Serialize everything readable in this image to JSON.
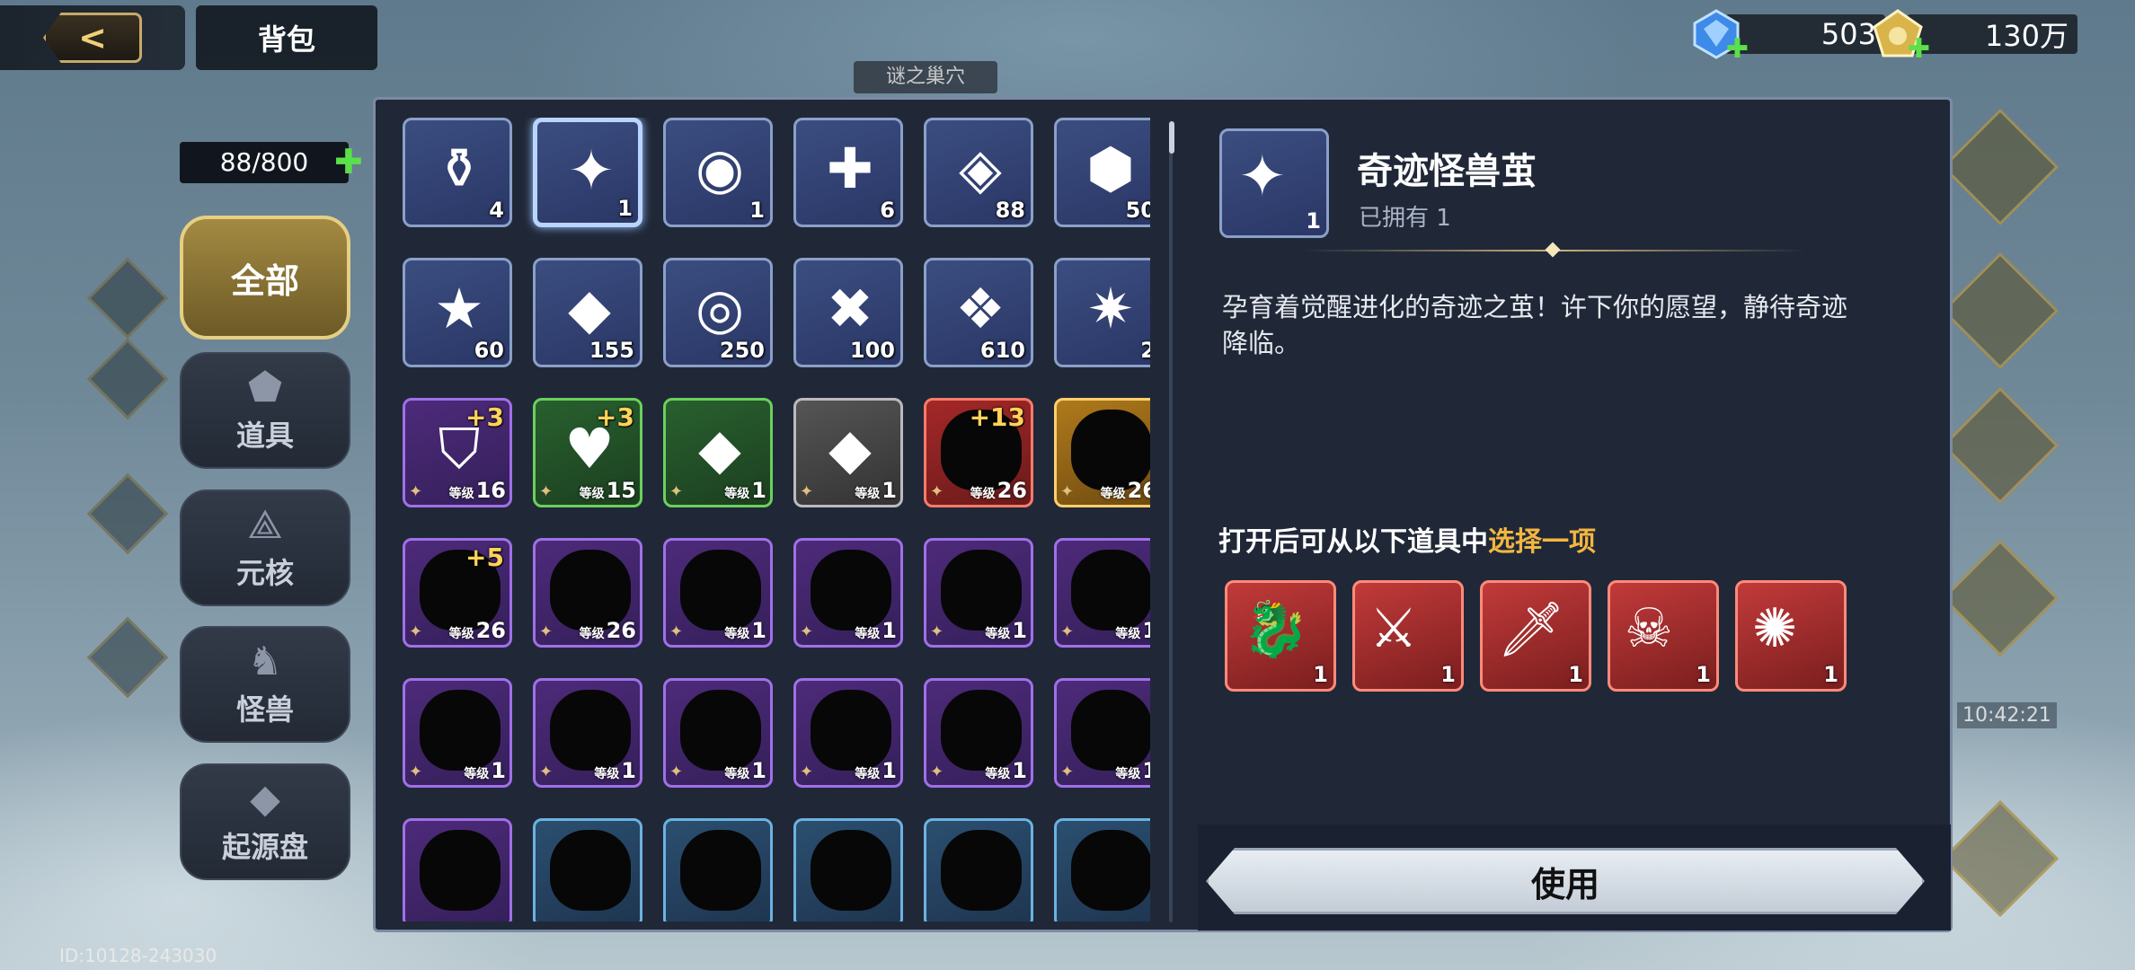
{
  "header": {
    "back_icon": "back-arrow-icon",
    "title": "背包",
    "sub_title": "谜之巢穴"
  },
  "currencies": [
    {
      "name": "blue-gem",
      "icon": "blue-crystal-icon",
      "value": "503",
      "color": "#4aa8ff"
    },
    {
      "name": "gold-coin",
      "icon": "gold-pentagon-icon",
      "value": "130万",
      "color": "#e6c65a"
    }
  ],
  "capacity": {
    "text": "88/800",
    "add_icon": "plus-icon"
  },
  "tabs": [
    {
      "label": "全部",
      "icon": "none",
      "active": true
    },
    {
      "label": "道具",
      "icon": "items-icon",
      "active": false
    },
    {
      "label": "元核",
      "icon": "core-icon",
      "active": false
    },
    {
      "label": "怪兽",
      "icon": "monster-icon",
      "active": false
    },
    {
      "label": "起源盘",
      "icon": "origin-disk-icon",
      "active": false
    }
  ],
  "items": [
    {
      "glyph": "⚱",
      "count": "4",
      "style": "blue"
    },
    {
      "glyph": "✦",
      "count": "1",
      "style": "blue",
      "selected": true
    },
    {
      "glyph": "◉",
      "count": "1",
      "style": "blue"
    },
    {
      "glyph": "✚",
      "count": "6",
      "style": "blue"
    },
    {
      "glyph": "◈",
      "count": "88",
      "style": "blue"
    },
    {
      "glyph": "⬢",
      "count": "50",
      "style": "blue"
    },
    {
      "glyph": "★",
      "count": "60",
      "style": "blue"
    },
    {
      "glyph": "◆",
      "count": "155",
      "style": "blue"
    },
    {
      "glyph": "◎",
      "count": "250",
      "style": "blue"
    },
    {
      "glyph": "✖",
      "count": "100",
      "style": "blue"
    },
    {
      "glyph": "❖",
      "count": "610",
      "style": "blue"
    },
    {
      "glyph": "✷",
      "count": "2",
      "style": "blue"
    },
    {
      "glyph": "⛉",
      "level_label": "等级",
      "level": "16",
      "plus": "+3",
      "style": "purple"
    },
    {
      "glyph": "♥",
      "level_label": "等级",
      "level": "15",
      "plus": "+3",
      "style": "green"
    },
    {
      "glyph": "◆",
      "level_label": "等级",
      "level": "1",
      "style": "green"
    },
    {
      "glyph": "◆",
      "level_label": "等级",
      "level": "1",
      "style": "gray"
    },
    {
      "silhouette": true,
      "level_label": "等级",
      "level": "26",
      "plus": "+13",
      "style": "red"
    },
    {
      "silhouette": true,
      "level_label": "等级",
      "level": "26",
      "style": "gold"
    },
    {
      "silhouette": true,
      "level_label": "等级",
      "level": "26",
      "plus": "+5",
      "style": "purple"
    },
    {
      "silhouette": true,
      "level_label": "等级",
      "level": "26",
      "style": "purple"
    },
    {
      "silhouette": true,
      "level_label": "等级",
      "level": "1",
      "style": "purple"
    },
    {
      "silhouette": true,
      "level_label": "等级",
      "level": "1",
      "style": "purple"
    },
    {
      "silhouette": true,
      "level_label": "等级",
      "level": "1",
      "style": "purple"
    },
    {
      "silhouette": true,
      "level_label": "等级",
      "level": "1",
      "style": "purple"
    },
    {
      "silhouette": true,
      "level_label": "等级",
      "level": "1",
      "style": "purple"
    },
    {
      "silhouette": true,
      "level_label": "等级",
      "level": "1",
      "style": "purple"
    },
    {
      "silhouette": true,
      "level_label": "等级",
      "level": "1",
      "style": "purple"
    },
    {
      "silhouette": true,
      "level_label": "等级",
      "level": "1",
      "style": "purple"
    },
    {
      "silhouette": true,
      "level_label": "等级",
      "level": "1",
      "style": "purple"
    },
    {
      "silhouette": true,
      "level_label": "等级",
      "level": "1",
      "style": "purple"
    },
    {
      "silhouette": true,
      "style": "purple"
    },
    {
      "silhouette": true,
      "style": "teal"
    },
    {
      "silhouette": true,
      "style": "teal"
    },
    {
      "silhouette": true,
      "style": "teal"
    },
    {
      "silhouette": true,
      "style": "teal"
    },
    {
      "silhouette": true,
      "style": "teal"
    }
  ],
  "detail": {
    "name": "奇迹怪兽茧",
    "count": "1",
    "owned": "已拥有 1",
    "description": "孕育着觉醒进化的奇迹之茧！许下你的愿望，静待奇迹降临。",
    "choose_prefix": "打开后可从以下道具中",
    "choose_highlight": "选择一项",
    "rewards": [
      {
        "glyph": "🐉",
        "count": "1"
      },
      {
        "glyph": "⚔",
        "count": "1"
      },
      {
        "glyph": "🗡",
        "count": "1"
      },
      {
        "glyph": "☠",
        "count": "1"
      },
      {
        "glyph": "✺",
        "count": "1"
      }
    ],
    "use_label": "使用"
  },
  "footer": {
    "id_text": "ID:10128-243030"
  },
  "background": {
    "time": "10:42:21"
  }
}
